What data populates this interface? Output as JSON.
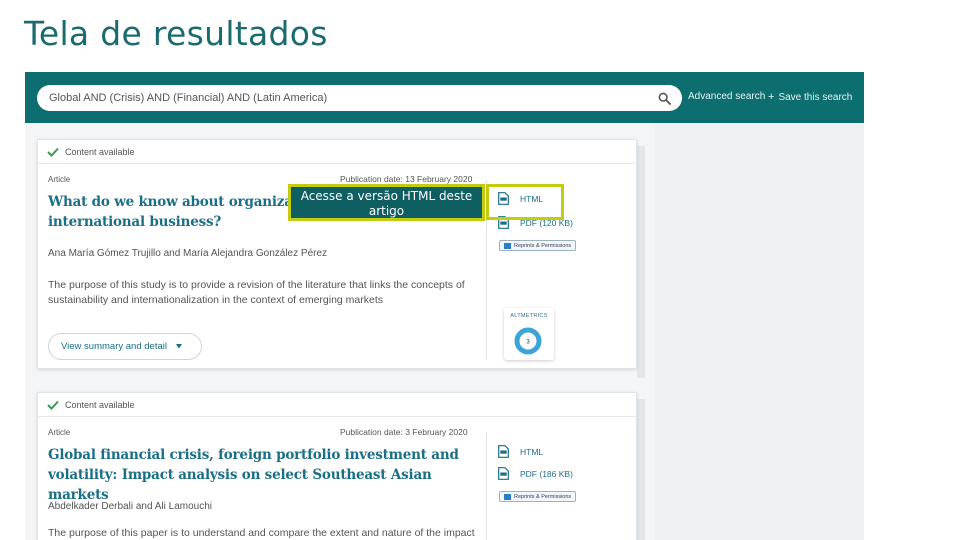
{
  "slide": {
    "title": "Tela de resultados"
  },
  "header": {
    "search_value": "Global AND (Crisis) AND (Financial) AND (Latin America)",
    "advanced_search": "Advanced search",
    "save_search": "Save this search",
    "save_plus": "+"
  },
  "results": [
    {
      "content_available": "Content available",
      "type": "Article",
      "publication_date": "Publication date: 13 February 2020",
      "title": "What do we know about organization… international business?",
      "title_line1": "What do we know about organization",
      "title_line2": "international business?",
      "authors": "Ana María Gómez Trujillo and María Alejandra González Pérez",
      "abstract": "The purpose of this study is to provide a revision of the literature that links the concepts of sustainability and internationalization in the context of emerging markets",
      "summary_button": "View summary and detail",
      "html_link": "HTML",
      "pdf_link": "PDF (120 KB)",
      "reprints": "Reprints & Permissions",
      "altmetric_label": "ALTMETRICS",
      "altmetric_score": "3"
    },
    {
      "content_available": "Content available",
      "type": "Article",
      "publication_date": "Publication date: 3 February 2020",
      "title": "Global financial crisis, foreign portfolio investment and volatility: Impact analysis on select Southeast Asian markets",
      "authors": "Abdelkader Derbali and Ali Lamouchi",
      "abstract": "The purpose of this paper is to understand and compare the extent and nature of the impact",
      "html_link": "HTML",
      "pdf_link": "PDF (186 KB)",
      "reprints": "Reprints & Permissions"
    }
  ],
  "callout": {
    "text": "Acesse a versão HTML deste artigo"
  },
  "colors": {
    "teal_bar": "#0c6e6e",
    "title_teal": "#1b6b6e",
    "link": "#1a6f86",
    "highlight": "#c2cc10"
  }
}
